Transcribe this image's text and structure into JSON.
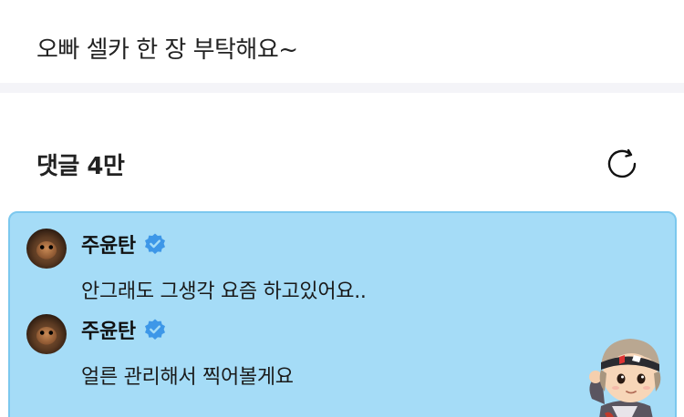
{
  "post": {
    "text": "오빠 셀카 한 장 부탁해요~"
  },
  "comments_section": {
    "header": "댓글 4만",
    "refresh_icon": "refresh-icon"
  },
  "reply_card": {
    "background": "#a5dcf7",
    "border": "#7cc8ee",
    "comments": [
      {
        "author": "주윤탄",
        "verified": true,
        "text": "안그래도 그생각 요즘 하고있어요.."
      },
      {
        "author": "주윤탄",
        "verified": true,
        "text": "얼른 관리해서 찍어볼게요"
      }
    ],
    "sticker": "character-sticker"
  },
  "colors": {
    "verified_badge": "#3d97e8",
    "separator": "#f4f4f8"
  }
}
